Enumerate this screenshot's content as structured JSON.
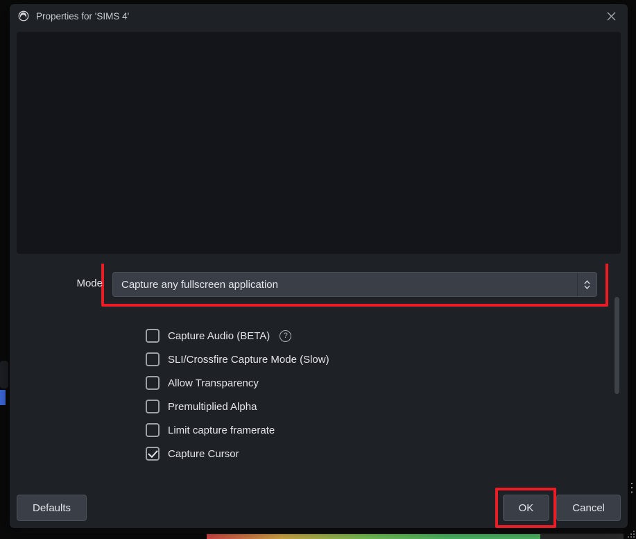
{
  "window": {
    "title": "Properties for 'SIMS 4'"
  },
  "mode": {
    "label": "Mode",
    "selected": "Capture any fullscreen application"
  },
  "checks": [
    {
      "label": "Capture Audio (BETA)",
      "checked": false,
      "help": true
    },
    {
      "label": "SLI/Crossfire Capture Mode (Slow)",
      "checked": false,
      "help": false
    },
    {
      "label": "Allow Transparency",
      "checked": false,
      "help": false
    },
    {
      "label": "Premultiplied Alpha",
      "checked": false,
      "help": false
    },
    {
      "label": "Limit capture framerate",
      "checked": false,
      "help": false
    },
    {
      "label": "Capture Cursor",
      "checked": true,
      "help": false
    }
  ],
  "buttons": {
    "defaults": "Defaults",
    "ok": "OK",
    "cancel": "Cancel"
  },
  "annotation": {
    "color": "#ec1c24"
  }
}
